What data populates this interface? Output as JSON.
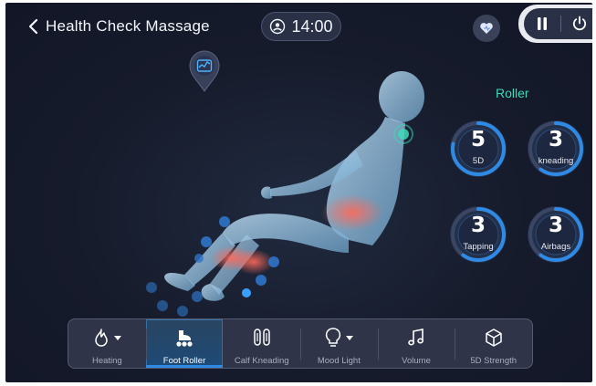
{
  "header": {
    "title": "Health Check Massage",
    "timer": "14:00",
    "icons": {
      "back": "chevron-left-icon",
      "timer": "timer-icon",
      "heart": "heart-icon",
      "pause": "pause-icon",
      "power": "power-icon"
    }
  },
  "map_pin": {
    "icon": "health-chart-icon"
  },
  "roller": {
    "title": "Roller",
    "dials": [
      {
        "value": "5",
        "label": "5D",
        "level": 0.78
      },
      {
        "value": "3",
        "label": "kneading",
        "level": 0.6
      },
      {
        "value": "3",
        "label": "Tapping",
        "level": 0.6
      },
      {
        "value": "3",
        "label": "Airbags",
        "level": 0.6
      }
    ]
  },
  "toolbar": {
    "items": [
      {
        "label": "Heating",
        "icon": "flame-icon",
        "has_dropdown": true,
        "active": false
      },
      {
        "label": "Foot Roller",
        "icon": "foot-roller-icon",
        "has_dropdown": false,
        "active": true
      },
      {
        "label": "Calf Kneading",
        "icon": "calf-kneading-icon",
        "has_dropdown": false,
        "active": false
      },
      {
        "label": "Mood Light",
        "icon": "light-bulb-icon",
        "has_dropdown": true,
        "active": false
      },
      {
        "label": "Volume",
        "icon": "music-note-icon",
        "has_dropdown": false,
        "active": false
      },
      {
        "label": "5D Strength",
        "icon": "cube-icon",
        "has_dropdown": false,
        "active": false
      }
    ]
  },
  "colors": {
    "accent": "#2f8ae6",
    "roller_title": "#3fd9b9",
    "background": "#161b2b"
  }
}
